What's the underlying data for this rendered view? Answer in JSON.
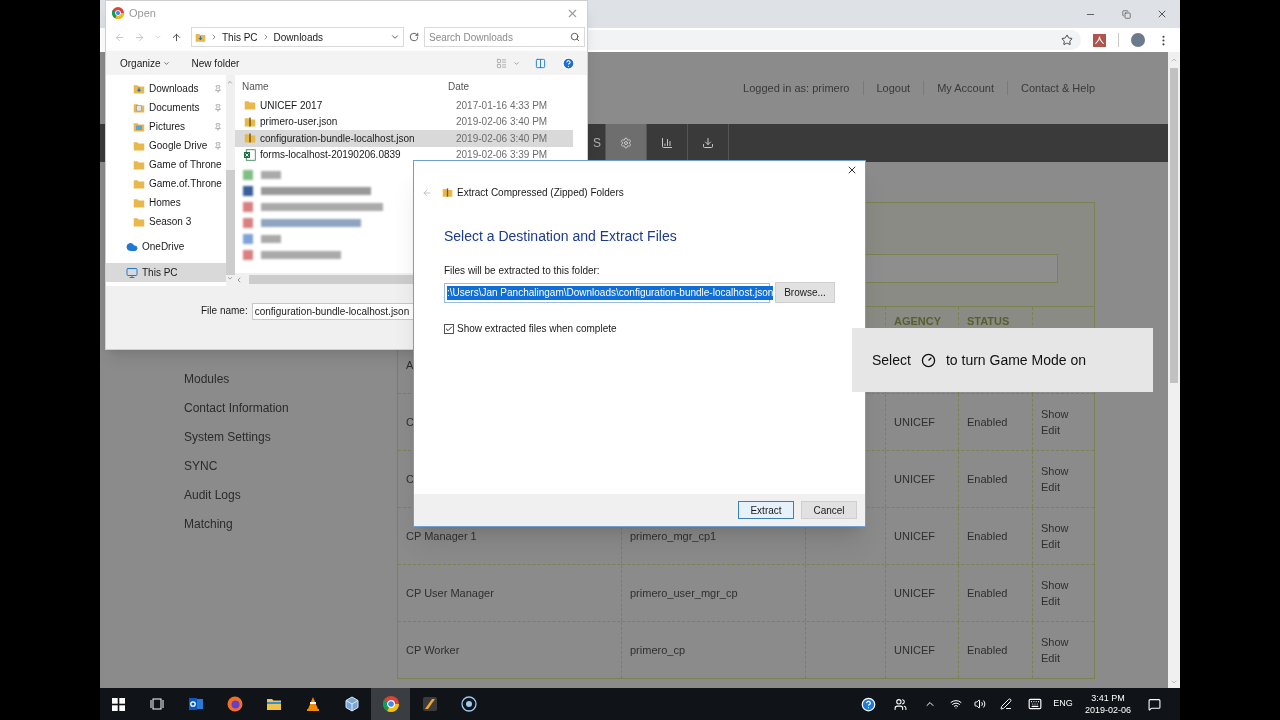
{
  "browser": {
    "page": {
      "header_links": [
        "Logged in as: primero",
        "Logout",
        "My Account",
        "Contact & Help"
      ],
      "nav_tabs": [
        {
          "kind": "text",
          "label": "S",
          "selected": false
        },
        {
          "kind": "gear",
          "selected": true
        },
        {
          "kind": "chart",
          "selected": false
        },
        {
          "kind": "download",
          "selected": false
        }
      ],
      "sidebar_items": [
        "Modules",
        "Contact Information",
        "System Settings",
        "SYNC",
        "Audit Logs",
        "Matching"
      ],
      "table": {
        "headings": {
          "column_4": "AGENCY",
          "column_5": "STATUS"
        },
        "rows": [
          {
            "column_1": "A"
          },
          {
            "column_1": "C",
            "column_4": "UNICEF",
            "column_5": "Enabled",
            "column_6": [
              "Show",
              "Edit"
            ]
          },
          {
            "column_1": "C",
            "column_4": "UNICEF",
            "column_5": "Enabled",
            "column_6": [
              "Show",
              "Edit"
            ]
          },
          {
            "column_1": "CP Manager 1",
            "column_2": "primero_mgr_cp1",
            "column_4": "UNICEF",
            "column_5": "Enabled",
            "column_6": [
              "Show",
              "Edit"
            ]
          },
          {
            "column_1": "CP User Manager",
            "column_2": "primero_user_mgr_cp",
            "column_4": "UNICEF",
            "column_5": "Enabled",
            "column_6": [
              "Show",
              "Edit"
            ]
          },
          {
            "column_1": "CP Worker",
            "column_2": "primero_cp",
            "column_4": "UNICEF",
            "column_5": "Enabled",
            "column_6": [
              "Show",
              "Edit"
            ]
          }
        ]
      }
    }
  },
  "open_dialog": {
    "title": "Open",
    "path": [
      "This PC",
      "Downloads"
    ],
    "search_placeholder": "Search Downloads",
    "toolbar": [
      "Organize",
      "New folder"
    ],
    "nav_items": [
      {
        "label": "Downloads",
        "kind": "downloads",
        "pinned": true,
        "selected": false
      },
      {
        "label": "Documents",
        "kind": "documents",
        "pinned": true,
        "selected": false
      },
      {
        "label": "Pictures",
        "kind": "pictures",
        "pinned": true,
        "selected": false
      },
      {
        "label": "Google Drive",
        "kind": "folder",
        "pinned": true,
        "selected": false
      },
      {
        "label": "Game of Throne",
        "kind": "folder",
        "pinned": false,
        "selected": false
      },
      {
        "label": "Game.of.Throne",
        "kind": "folder",
        "pinned": false,
        "selected": false
      },
      {
        "label": "Homes",
        "kind": "folder",
        "pinned": false,
        "selected": false
      },
      {
        "label": "Season 3",
        "kind": "folder",
        "pinned": false,
        "selected": false
      },
      {
        "label": "OneDrive",
        "kind": "cloud",
        "pinned": false,
        "selected": false
      },
      {
        "label": "This PC",
        "kind": "pc",
        "pinned": false,
        "selected": true
      }
    ],
    "columns": [
      "Name",
      "Date"
    ],
    "files": [
      {
        "name": "UNICEF 2017",
        "date": "2017-01-16 4:33 PM",
        "kind": "folder",
        "selected": false
      },
      {
        "name": "primero-user.json",
        "date": "2019-02-06 3:40 PM",
        "kind": "zip",
        "selected": false
      },
      {
        "name": "configuration-bundle-localhost.json",
        "date": "2019-02-06 3:40 PM",
        "kind": "zip",
        "selected": true
      },
      {
        "name": "forms-localhost-20190206.0839",
        "date": "2019-02-06 3:39 PM",
        "kind": "sheet",
        "selected": false
      }
    ],
    "file_name_label": "File name:",
    "file_name": "configuration-bundle-localhost.json"
  },
  "extract_dialog": {
    "title": "Extract Compressed (Zipped) Folders",
    "heading": "Select a Destination and Extract Files",
    "prompt": "Files will be extracted to this folder:",
    "path": ":\\Users\\Jan Panchalingam\\Downloads\\configuration-bundle-localhost.json",
    "browse": "Browse...",
    "show_files": {
      "label": "Show extracted files when complete",
      "checked": true
    },
    "buttons": [
      "Extract",
      "Cancel"
    ]
  },
  "game_mode_toast": {
    "before": "Select",
    "after": "to turn Game Mode on"
  },
  "taskbar": {
    "apps": [
      {
        "kind": "outlook",
        "active": false
      },
      {
        "kind": "firefox",
        "active": false
      },
      {
        "kind": "explorer",
        "active": false
      },
      {
        "kind": "vlc",
        "active": false
      },
      {
        "kind": "virtualbox",
        "active": false
      },
      {
        "kind": "chrome",
        "active": true
      },
      {
        "kind": "app",
        "active": false
      },
      {
        "kind": "recorder",
        "active": false
      }
    ],
    "language": "ENG",
    "time": "3:41 PM",
    "date": "2019-02-06"
  }
}
